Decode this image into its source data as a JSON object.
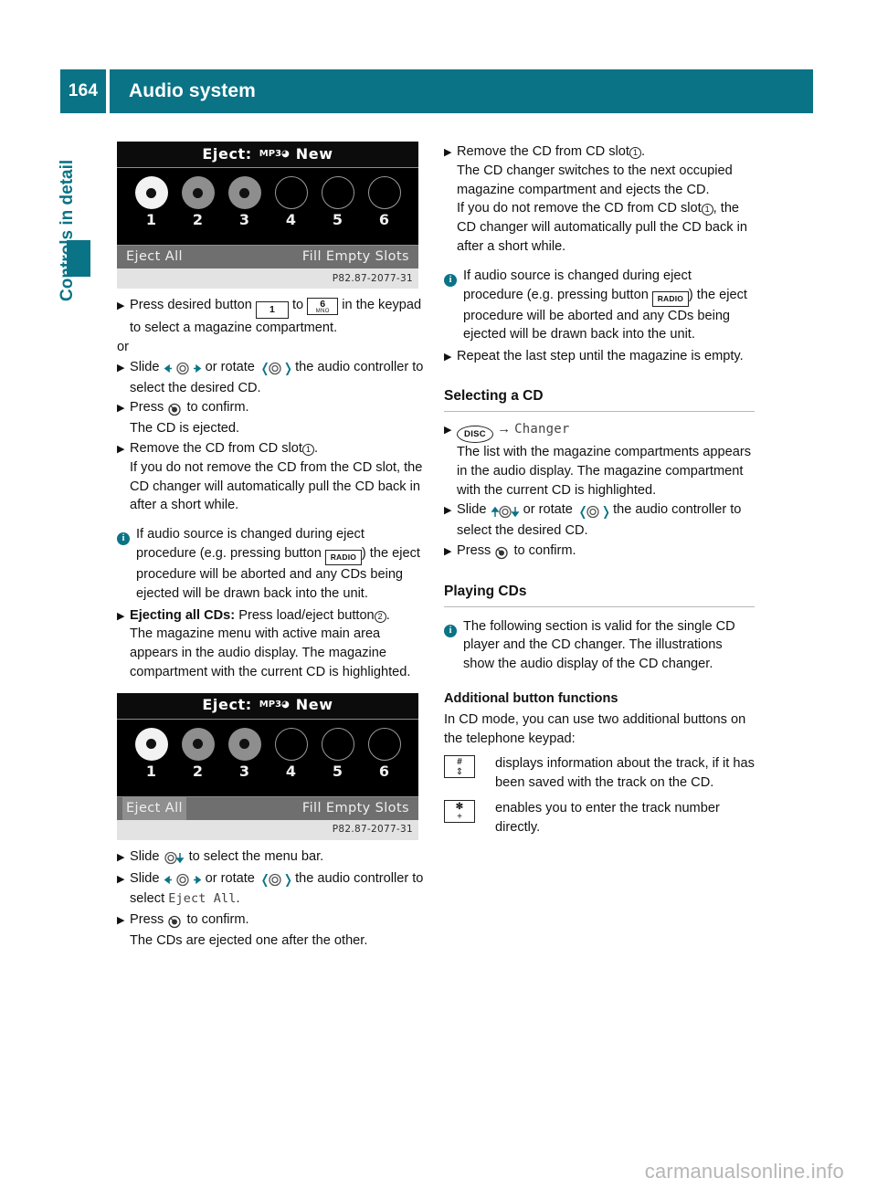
{
  "header": {
    "page_number": "164",
    "title": "Audio system",
    "accent_color": "#0a7386"
  },
  "side_tab": {
    "label": "Controls in detail"
  },
  "figure_1": {
    "title_prefix": "Eject:",
    "title_badge": "MP3",
    "title_suffix": "New",
    "discs": [
      {
        "num": "1",
        "state": "full-white"
      },
      {
        "num": "2",
        "state": "full-grey"
      },
      {
        "num": "3",
        "state": "full-grey"
      },
      {
        "num": "4",
        "state": "empty"
      },
      {
        "num": "5",
        "state": "empty"
      },
      {
        "num": "6",
        "state": "empty"
      }
    ],
    "bar_left": "Eject All",
    "bar_right": "Fill Empty Slots",
    "bar_active": false,
    "caption": "P82.87-2077-31"
  },
  "figure_2": {
    "title_prefix": "Eject:",
    "title_badge": "MP3",
    "title_suffix": "New",
    "discs": [
      {
        "num": "1",
        "state": "full-white"
      },
      {
        "num": "2",
        "state": "full-grey"
      },
      {
        "num": "3",
        "state": "full-grey"
      },
      {
        "num": "4",
        "state": "empty"
      },
      {
        "num": "5",
        "state": "empty"
      },
      {
        "num": "6",
        "state": "empty"
      }
    ],
    "bar_left": "Eject All",
    "bar_right": "Fill Empty Slots",
    "bar_active": true,
    "caption": "P82.87-2077-31"
  },
  "left_column": {
    "step_press_button_pre": "Press desired button",
    "key_1_main": "1",
    "step_press_button_mid": "to",
    "key_6_main": "6",
    "key_6_sub": "MNO",
    "step_press_button_post": "in the keypad to select a magazine compartment.",
    "or": "or",
    "step_slide_pre": "Slide",
    "step_slide_mid": "or rotate",
    "step_slide_post": "the audio controller to select the desired CD.",
    "step_press_confirm_pre": "Press",
    "step_press_confirm_post": "to confirm.",
    "step_press_confirm_result": "The CD is ejected.",
    "step_remove_pre": "Remove the CD from CD slot",
    "step_remove_slot": "1",
    "step_remove_post": ".",
    "step_remove_detail": "If you do not remove the CD from the CD slot, the CD changer will automatically pull the CD back in after a short while.",
    "note_eject_pre": "If audio source is changed during eject procedure (e.g. pressing button",
    "note_eject_key": "RADIO",
    "note_eject_post": ") the eject procedure will be aborted and any CDs being ejected will be drawn back into the unit.",
    "step_eject_all_label": "Ejecting all CDs:",
    "step_eject_all_pre": "Press load/eject button",
    "step_eject_all_slot": "2",
    "step_eject_all_post": ".",
    "step_eject_all_detail": "The magazine menu with active main area appears in the audio display. The magazine compartment with the current CD is highlighted.",
    "step_slide_menu_pre": "Slide",
    "step_slide_menu_post": "to select the menu bar.",
    "step_slide_eject_pre": "Slide",
    "step_slide_eject_mid": "or rotate",
    "step_slide_eject_post": "the audio controller to select",
    "step_slide_eject_target": "Eject All",
    "step_slide_eject_end": ".",
    "step_confirm_pre": "Press",
    "step_confirm_post": "to confirm.",
    "step_confirm_result": "The CDs are ejected one after the other."
  },
  "right_column": {
    "step_remove_pre": "Remove the CD from CD slot",
    "step_remove_slot": "1",
    "step_remove_post": ".",
    "step_remove_detail_1": "The CD changer switches to the next occupied magazine compartment and ejects the CD.",
    "step_remove_detail_2_pre": "If you do not remove the CD from CD slot",
    "step_remove_detail_2_slot": "1",
    "step_remove_detail_2_post": ", the CD changer will automatically pull the CD back in after a short while.",
    "note_eject_pre": "If audio source is changed during eject procedure (e.g. pressing button",
    "note_eject_key": "RADIO",
    "note_eject_post": ") the eject procedure will be aborted and any CDs being ejected will be drawn back into the unit.",
    "step_repeat": "Repeat the last step until the magazine is empty.",
    "section_selecting_a_cd": "Selecting a CD",
    "disc_key": "DISC",
    "disc_arrow": "→",
    "disc_target": "Changer",
    "selecting_detail": "The list with the magazine compartments appears in the audio display. The magazine compartment with the current CD is highlighted.",
    "step_slide_pre": "Slide",
    "step_slide_mid": "or rotate",
    "step_slide_post": "the audio controller to select the desired CD.",
    "step_confirm_pre": "Press",
    "step_confirm_post": "to confirm.",
    "section_playing_cds": "Playing CDs",
    "note_playing": "The following section is valid for the single CD player and the CD changer. The illustrations show the audio display of the CD changer.",
    "subsection_additional": "Additional button functions",
    "additional_intro": "In CD mode, you can use two additional buttons on the telephone keypad:",
    "keypad_rows": [
      {
        "key_top": "#",
        "key_bottom": "⇕",
        "description": "displays information about the track, if it has been saved with the track on the CD."
      },
      {
        "key_top": "✻",
        "key_bottom": "+",
        "description": "enables you to enter the track number directly."
      }
    ]
  },
  "watermark": {
    "text": "carmanualsonline.info"
  }
}
